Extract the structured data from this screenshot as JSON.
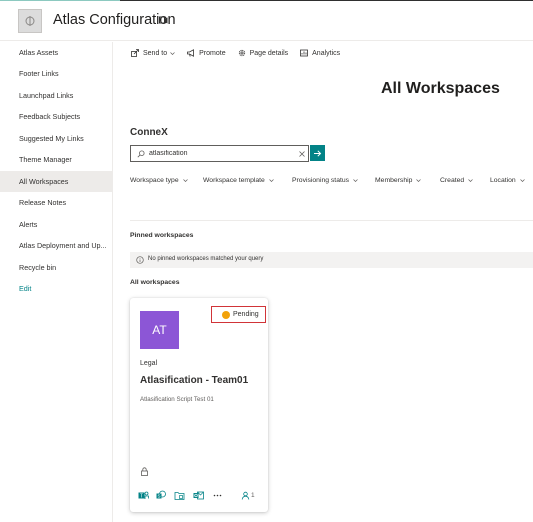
{
  "site": {
    "title": "Atlas Configuration",
    "logo_icon": "site-logo-icon",
    "accent_color": "#038387"
  },
  "sidebar": {
    "items": [
      {
        "label": "Atlas Assets"
      },
      {
        "label": "Footer Links"
      },
      {
        "label": "Launchpad Links"
      },
      {
        "label": "Feedback Subjects"
      },
      {
        "label": "Suggested My Links"
      },
      {
        "label": "Theme Manager"
      },
      {
        "label": "All Workspaces",
        "selected": true
      },
      {
        "label": "Release Notes"
      },
      {
        "label": "Alerts"
      },
      {
        "label": "Atlas Deployment and Up..."
      },
      {
        "label": "Recycle bin"
      }
    ],
    "edit_label": "Edit"
  },
  "commandbar": {
    "send_to": "Send to",
    "promote": "Promote",
    "page_details": "Page details",
    "analytics": "Analytics"
  },
  "page": {
    "title": "All Workspaces",
    "section_name": "ConneX"
  },
  "search": {
    "value": "atlasification",
    "icon": "search-icon"
  },
  "filters": [
    "Workspace type",
    "Workspace template",
    "Provisioning status",
    "Membership",
    "Created",
    "Location"
  ],
  "pinned": {
    "heading": "Pinned workspaces",
    "empty_message": "No pinned workspaces matched your query"
  },
  "all_workspaces": {
    "heading": "All workspaces",
    "cards": [
      {
        "initials": "AT",
        "avatar_color": "#8c56d6",
        "status": "Pending",
        "status_color": "#f2a20a",
        "category": "Legal",
        "title": "Atlasification - Team01",
        "description": "Atlasification Script Test 01",
        "member_count": "1"
      }
    ]
  }
}
